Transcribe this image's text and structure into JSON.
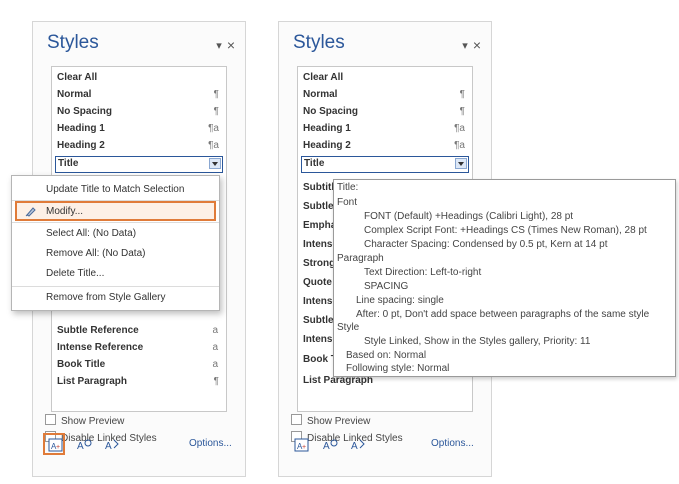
{
  "left_pane": {
    "title": "Styles",
    "items": [
      {
        "label": "Clear All",
        "mark": ""
      },
      {
        "label": "Normal",
        "mark": "¶"
      },
      {
        "label": "No Spacing",
        "mark": "¶"
      },
      {
        "label": "Heading 1",
        "mark": "¶a"
      },
      {
        "label": "Heading 2",
        "mark": "¶a"
      },
      {
        "label": "Title",
        "mark": ""
      },
      {
        "label": "Subtle Reference",
        "mark": "a"
      },
      {
        "label": "Intense Reference",
        "mark": "a"
      },
      {
        "label": "Book Title",
        "mark": "a"
      },
      {
        "label": "List Paragraph",
        "mark": "¶"
      }
    ],
    "show_preview": "Show Preview",
    "disable_linked": "Disable Linked Styles",
    "options": "Options..."
  },
  "context_menu": {
    "items": [
      "Update Title to Match Selection",
      "Modify...",
      "Select All: (No Data)",
      "Remove All: (No Data)",
      "Delete Title...",
      "Remove from Style Gallery"
    ]
  },
  "right_pane": {
    "title": "Styles",
    "items": [
      {
        "label": "Clear All",
        "mark": ""
      },
      {
        "label": "Normal",
        "mark": "¶"
      },
      {
        "label": "No Spacing",
        "mark": "¶"
      },
      {
        "label": "Heading 1",
        "mark": "¶a"
      },
      {
        "label": "Heading 2",
        "mark": "¶a"
      },
      {
        "label": "Title",
        "mark": ""
      },
      {
        "label": "Subtitle",
        "mark": ""
      },
      {
        "label": "Subtle Emphasis",
        "mark": ""
      },
      {
        "label": "Emphasis",
        "mark": ""
      },
      {
        "label": "Intense Emphasis",
        "mark": ""
      },
      {
        "label": "Strong",
        "mark": ""
      },
      {
        "label": "Quote",
        "mark": ""
      },
      {
        "label": "Intense Quote",
        "mark": ""
      },
      {
        "label": "Subtle Reference",
        "mark": ""
      },
      {
        "label": "Intense Reference",
        "mark": ""
      },
      {
        "label": "Book Title",
        "mark": ""
      },
      {
        "label": "List Paragraph",
        "mark": ""
      }
    ],
    "show_preview": "Show Preview",
    "disable_linked": "Disable Linked Styles",
    "options": "Options..."
  },
  "tooltip": {
    "title": "Title:",
    "font_heading": "Font",
    "font_1": "FONT  (Default) +Headings (Calibri Light), 28 pt",
    "font_2": "Complex Script Font: +Headings CS (Times New Roman), 28 pt",
    "font_3": "Character Spacing: Condensed by  0.5 pt, Kern at 14 pt",
    "para_heading": "Paragraph",
    "para_1": "Text Direction: Left-to-right",
    "para_2": "SPACING",
    "para_3": "Line spacing:  single",
    "para_4": "After:  0 pt, Don't add space between paragraphs of the same style",
    "style_heading": "Style",
    "style_1": "Style Linked, Show in the Styles gallery, Priority: 11",
    "based_on": "Based on: Normal",
    "following": "Following style: Normal"
  },
  "accent_color": "#e07b39",
  "brand_color": "#2b579a"
}
